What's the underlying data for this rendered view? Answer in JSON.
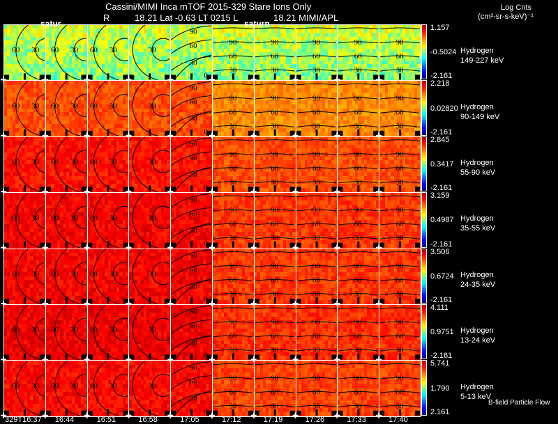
{
  "header": {
    "title_line1": "Cassini/MIMI Inca mTOF  2015-329    Stare    Ions Only",
    "title_line2_left": "R",
    "title_line2_mid": "18.21 Lat -0.63 LT 0215 L",
    "title_line2_right": "18.21   MIMI/APL",
    "overlay_label_1": "satur",
    "overlay_label_2": "saturn",
    "colorbar_title": "Log Cnts",
    "colorbar_units": "(cm²-sr-s-keV)⁻¹",
    "footer_note": "B-field Particle Flow"
  },
  "chart_data": {
    "type": "heatmap",
    "title": "Cassini/MIMI Inca mTOF  2015-329    Stare    Ions Only",
    "colorbar_label": "Log Cnts (cm²-sr-s-keV)⁻¹",
    "colormap": "jet",
    "times": [
      "329T16:37",
      "16:44",
      "16:51",
      "16:58",
      "17:05",
      "17:12",
      "17:19",
      "17:26",
      "17:33",
      "17:40"
    ],
    "contour_levels": [
      "0",
      "30",
      "60",
      "90",
      "120"
    ],
    "rows": [
      {
        "species": "Hydrogen",
        "energy": "149-227 keV",
        "max": "1.157",
        "mid": "-0.5024",
        "min": "-2.161",
        "level": 0.58
      },
      {
        "species": "Hydrogen",
        "energy": "90-149 keV",
        "max": "2.218",
        "mid": "0.02820",
        "min": "-2.161",
        "level": 0.76
      },
      {
        "species": "Hydrogen",
        "energy": "55-90 keV",
        "max": "2.845",
        "mid": "0.3417",
        "min": "-2.161",
        "level": 0.82
      },
      {
        "species": "Hydrogen",
        "energy": "35-55 keV",
        "max": "3.159",
        "mid": "0.4987",
        "min": "-2.161",
        "level": 0.84
      },
      {
        "species": "Hydrogen",
        "energy": "24-35 keV",
        "max": "3.506",
        "mid": "0.6724",
        "min": "-2.161",
        "level": 0.84
      },
      {
        "species": "Hydrogen",
        "energy": "13-24 keV",
        "max": "4.111",
        "mid": "0.9751",
        "min": "-2.161",
        "level": 0.85
      },
      {
        "species": "Hydrogen",
        "energy": "5-13 keV",
        "max": "5.741",
        "mid": "1.790",
        "min": "2.161",
        "level": 0.83
      }
    ]
  }
}
